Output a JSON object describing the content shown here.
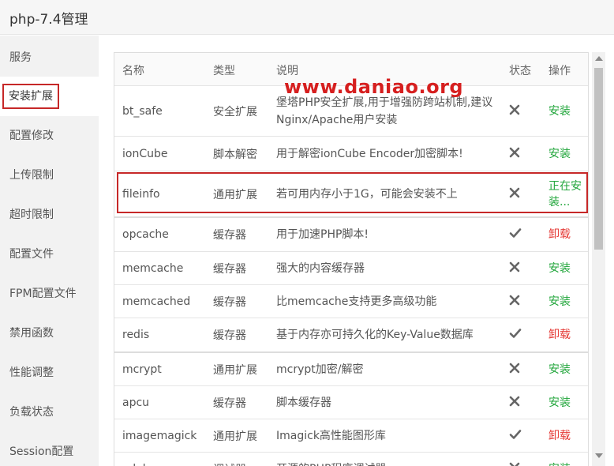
{
  "window": {
    "title": "php-7.4管理"
  },
  "watermark": "www.daniao.org",
  "sidebar": {
    "items": [
      {
        "label": "服务"
      },
      {
        "label": "安装扩展",
        "active": true
      },
      {
        "label": "配置修改"
      },
      {
        "label": "上传限制"
      },
      {
        "label": "超时限制"
      },
      {
        "label": "配置文件"
      },
      {
        "label": "FPM配置文件"
      },
      {
        "label": "禁用函数"
      },
      {
        "label": "性能调整"
      },
      {
        "label": "负载状态"
      },
      {
        "label": "Session配置"
      }
    ]
  },
  "table": {
    "headers": {
      "name": "名称",
      "type": "类型",
      "desc": "说明",
      "status": "状态",
      "op": "操作"
    },
    "rows": [
      {
        "name": "bt_safe",
        "type": "安全扩展",
        "desc": "堡塔PHP安全扩展,用于增强防跨站机制,建议Nginx/Apache用户安装",
        "installed": false,
        "op": "安装"
      },
      {
        "name": "ionCube",
        "type": "脚本解密",
        "desc": "用于解密ionCube Encoder加密脚本!",
        "installed": false,
        "op": "安装"
      },
      {
        "name": "fileinfo",
        "type": "通用扩展",
        "desc": "若可用内存小于1G，可能会安装不上",
        "installed": false,
        "op": "正在安装..."
      },
      {
        "name": "opcache",
        "type": "缓存器",
        "desc": "用于加速PHP脚本!",
        "installed": true,
        "op": "卸载"
      },
      {
        "name": "memcache",
        "type": "缓存器",
        "desc": "强大的内容缓存器",
        "installed": false,
        "op": "安装"
      },
      {
        "name": "memcached",
        "type": "缓存器",
        "desc": "比memcache支持更多高级功能",
        "installed": false,
        "op": "安装"
      },
      {
        "name": "redis",
        "type": "缓存器",
        "desc": "基于内存亦可持久化的Key-Value数据库",
        "installed": true,
        "op": "卸载"
      },
      {
        "name": "mcrypt",
        "type": "通用扩展",
        "desc": "mcrypt加密/解密",
        "installed": false,
        "op": "安装"
      },
      {
        "name": "apcu",
        "type": "缓存器",
        "desc": "脚本缓存器",
        "installed": false,
        "op": "安装"
      },
      {
        "name": "imagemagick",
        "type": "通用扩展",
        "desc": "Imagick高性能图形库",
        "installed": true,
        "op": "卸载"
      },
      {
        "name": "xdebug",
        "type": "调试器",
        "desc": "开源的PHP程序调试器",
        "installed": false,
        "op": "安装"
      }
    ]
  },
  "colors": {
    "install": "#20a53a",
    "uninstall": "#e53935",
    "highlight": "#c62828"
  }
}
